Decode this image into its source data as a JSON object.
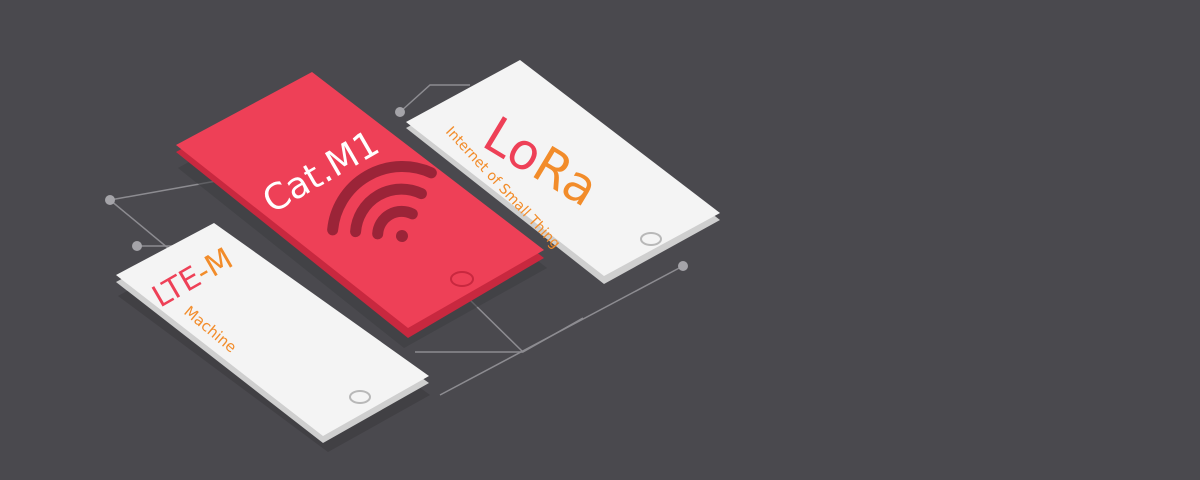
{
  "colors": {
    "background": "#4a494e",
    "primary_red": "#ee4057",
    "card_white": "#f4f4f4",
    "accent_orange": "#f28c2a",
    "connector_line": "#8d8c91"
  },
  "cards": [
    {
      "id": "cat-m1",
      "title": "Cat.M1",
      "icon": "wifi-icon",
      "home_button": "home-button-icon"
    },
    {
      "id": "lora",
      "title_first": "Lo",
      "title_second": "Ra",
      "subtitle": "Internet of Small Thing",
      "home_button": "home-button-icon"
    },
    {
      "id": "lte-m",
      "title_first": "LTE",
      "title_second": "-M",
      "subtitle": "Machine",
      "home_button": "home-button-icon"
    }
  ]
}
